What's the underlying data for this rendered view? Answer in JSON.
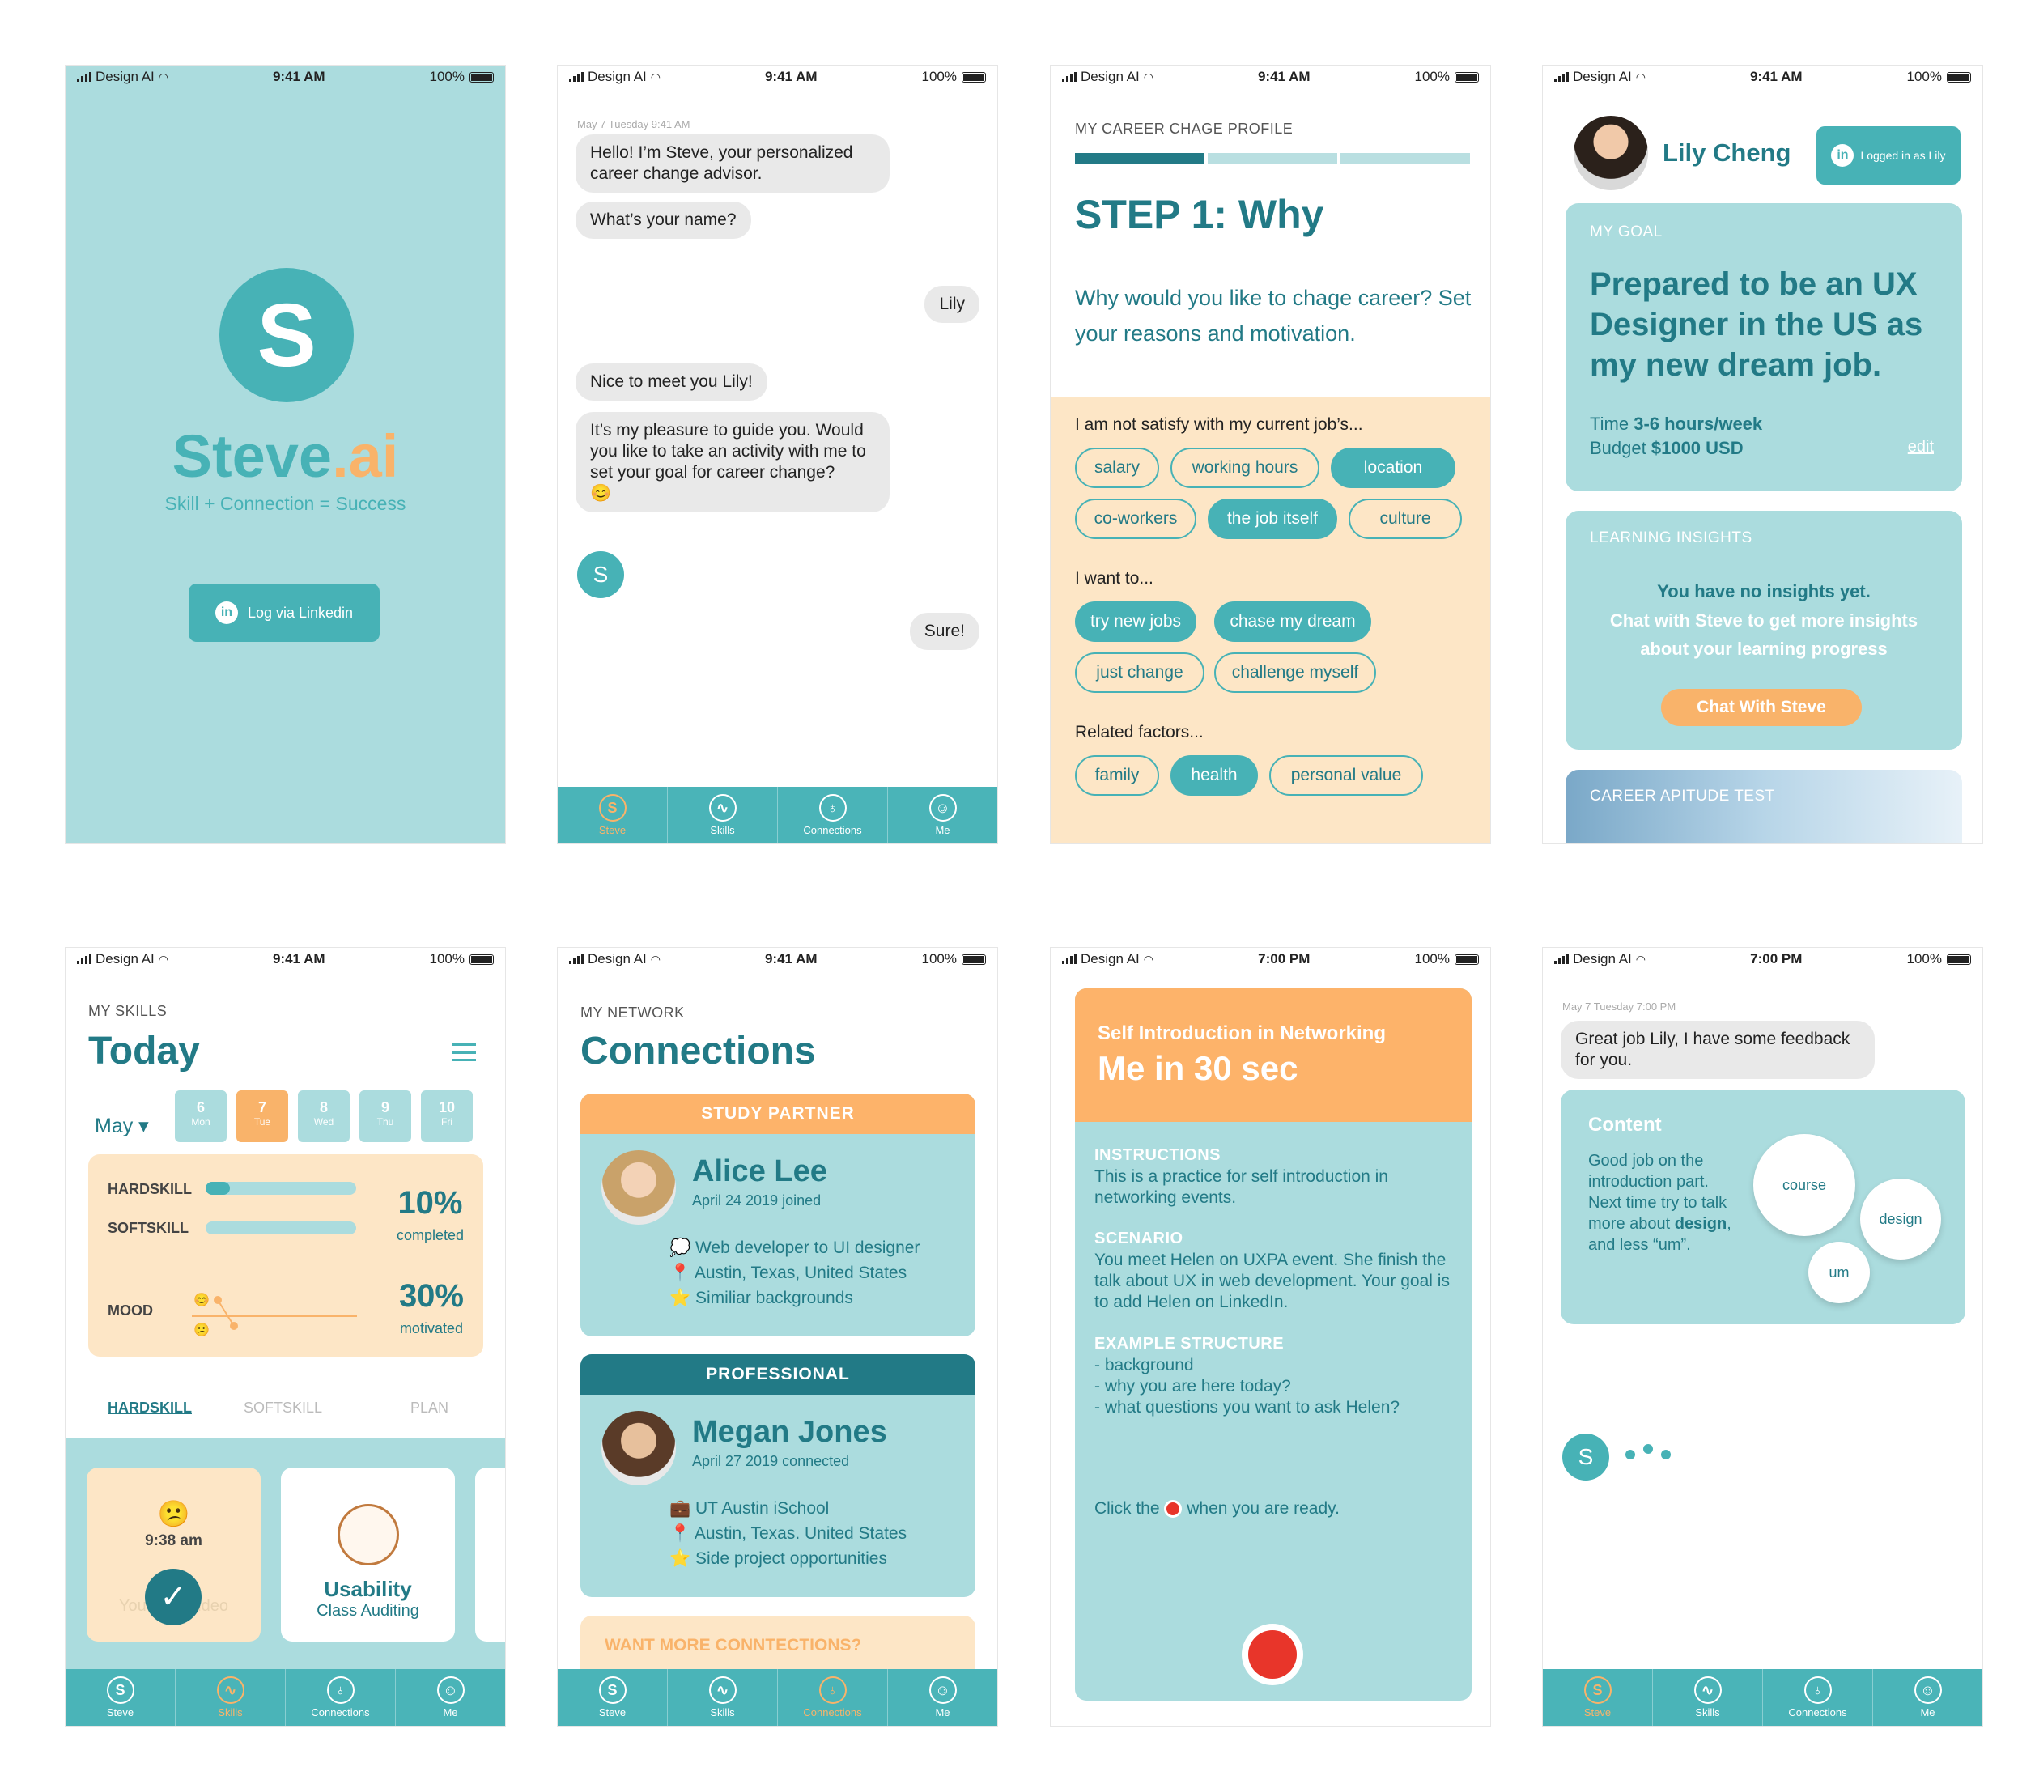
{
  "status": {
    "carrier": "Design AI",
    "time": "9:41 AM",
    "time_evening": "7:00 PM",
    "battery": "100%"
  },
  "tabs": {
    "steve": "Steve",
    "skills": "Skills",
    "connections": "Connections",
    "me": "Me"
  },
  "splash": {
    "logo_letter": "S",
    "brand_main": "Steve",
    "brand_accent": ".ai",
    "slogan": "Skill + Connection = Success",
    "login_label": "Log via Linkedin"
  },
  "chat": {
    "timestamp": "May 7 Tuesday 9:41 AM",
    "m1": "Hello! I’m Steve, your personalized career change advisor.",
    "m2": "What’s your name?",
    "r1": "Lily",
    "m3": "Nice to meet you Lily!",
    "m4": "It’s my pleasure to guide you. Would you like to take an activity with me to set your goal for career change?",
    "m4_emoji": "😊",
    "avatar": "S",
    "r2": "Sure!"
  },
  "profile": {
    "caption": "MY CAREER CHAGE PROFILE",
    "step": "STEP 1: Why",
    "question": "Why would you like to chage career? Set your reasons and motivation.",
    "g1_label": "I am not satisfy with my current job’s...",
    "g1": [
      "salary",
      "working hours",
      "location",
      "co-workers",
      "the job itself",
      "culture"
    ],
    "g2_label": "I want to...",
    "g2": [
      "try new jobs",
      "chase my dream",
      "just change",
      "challenge myself"
    ],
    "g3_label": "Related factors...",
    "g3": [
      "family",
      "health",
      "personal value"
    ]
  },
  "me": {
    "name": "Lily Cheng",
    "logged": "Logged in as Lily",
    "goal_cap": "MY GOAL",
    "goal": "Prepared to be an UX Designer in the US as my new dream job.",
    "time_label": "Time",
    "time_value": "3-6 hours/week",
    "budget_label": "Budget",
    "budget_value": "$1000 USD",
    "edit": "edit",
    "insights_cap": "LEARNING INSIGHTS",
    "insight_1": "You have no insights yet.",
    "insight_2": "Chat with Steve to get more insights about your learning progress",
    "chat_btn": "Chat With Steve",
    "aptitude": "CAREER APITUDE TEST"
  },
  "skills": {
    "caption": "MY SKILLS",
    "title": "Today",
    "month": "May ▾",
    "days": [
      {
        "n": "6",
        "d": "Mon"
      },
      {
        "n": "7",
        "d": "Tue"
      },
      {
        "n": "8",
        "d": "Wed"
      },
      {
        "n": "9",
        "d": "Thu"
      },
      {
        "n": "10",
        "d": "Fri"
      }
    ],
    "hard": "HARDSKILL",
    "soft": "SOFTSKILL",
    "mood": "MOOD",
    "pct1": "10%",
    "pct1_sub": "completed",
    "pct2": "30%",
    "pct2_sub": "motivated",
    "tab1": "HARDSKILL",
    "tab2": "SOFTSKILL",
    "tab3": "PLAN",
    "c1_emoji": "😕",
    "c1_time": "9:38 am",
    "c1_faded": "YouTube Video",
    "c2_title": "Usability",
    "c2_sub": "Class Auditing",
    "hard_progress": 0.16,
    "mood_emoji_top": "😊",
    "mood_emoji_bottom": "😕"
  },
  "network": {
    "caption": "MY NETWORK",
    "title": "Connections",
    "p1_head": "STUDY PARTNER",
    "p1_name": "Alice Lee",
    "p1_date": "April 24 2019 joined",
    "p1_l1": "💭 Web developer to UI designer",
    "p1_l2": "📍 Austin, Texas, United States",
    "p1_l3": "⭐ Similiar backgrounds",
    "p2_head": "PROFESSIONAL",
    "p2_name": "Megan Jones",
    "p2_date": "April 27 2019 connected",
    "p2_l1": "💼 UT Austin iSchool",
    "p2_l2": "📍 Austin, Texas. United States",
    "p2_l3": "⭐ Side project opportunities",
    "more": "WANT MORE CONNTECTIONS?"
  },
  "intro": {
    "sub": "Self Introduction in Networking",
    "title": "Me in 30 sec",
    "h1": "INSTRUCTIONS",
    "t1": "This is a practice for self introduction in networking events.",
    "h2": "SCENARIO",
    "t2": "You meet Helen on UXPA event. She finish the talk about UX in web development. Your goal is to add Helen on LinkedIn.",
    "h3": "EXAMPLE STRUCTURE",
    "t3a": "- background",
    "t3b": "- why you are here today?",
    "t3c": "- what questions you want to ask Helen?",
    "ready_pre": "Click the",
    "ready_post": "when you are ready."
  },
  "feedback": {
    "timestamp": "May 7 Tuesday 7:00 PM",
    "msg": "Great job Lily, I have some feedback for you.",
    "head": "Content",
    "text_pre": "Good job on the introduction part. Next time try to talk more about",
    "text_bold": "design",
    "text_post": ", and less “um”.",
    "w1": "course",
    "w2": "design",
    "w3": "um",
    "avatar": "S"
  },
  "colors": {
    "teal": "#47b2b6",
    "dark_teal": "#227a86",
    "light_teal": "#abdcde",
    "orange": "#f9b36a",
    "peach": "#fde6c6",
    "record": "#e8352a"
  }
}
